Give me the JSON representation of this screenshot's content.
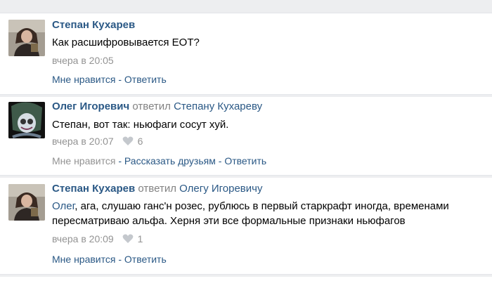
{
  "comments": [
    {
      "author": "Степан Кухарев",
      "replied_word": "",
      "reply_to": "",
      "mention": "",
      "text": "Как расшифровывается ЕОТ?",
      "time": "вчера в 20:05",
      "likes": "",
      "like_label": "Мне нравится",
      "sep": " - ",
      "share_label": "",
      "reply_label": "Ответить"
    },
    {
      "author": "Олег Игоревич",
      "replied_word": "ответил",
      "reply_to": "Степану Кухареву",
      "mention": "",
      "text": "Степан, вот так: ньюфаги сосут хуй.",
      "time": "вчера в 20:07",
      "likes": "6",
      "like_label": "Мне нравится",
      "sep": " - ",
      "share_label": "Рассказать друзьям",
      "reply_label": "Ответить"
    },
    {
      "author": "Степан Кухарев",
      "replied_word": "ответил",
      "reply_to": "Олегу Игоревичу",
      "mention": "Олег",
      "text": ", ага, слушаю ганс'н розес, рублюсь в первый старкрафт иногда, временами пересматриваю альфа. Херня эти все формальные признаки ньюфагов",
      "time": "вчера в 20:09",
      "likes": "1",
      "like_label": "Мне нравится",
      "sep": " - ",
      "share_label": "",
      "reply_label": "Ответить"
    }
  ],
  "colors": {
    "link": "#2a5885",
    "meta": "#939393",
    "divider": "#edeef0"
  }
}
